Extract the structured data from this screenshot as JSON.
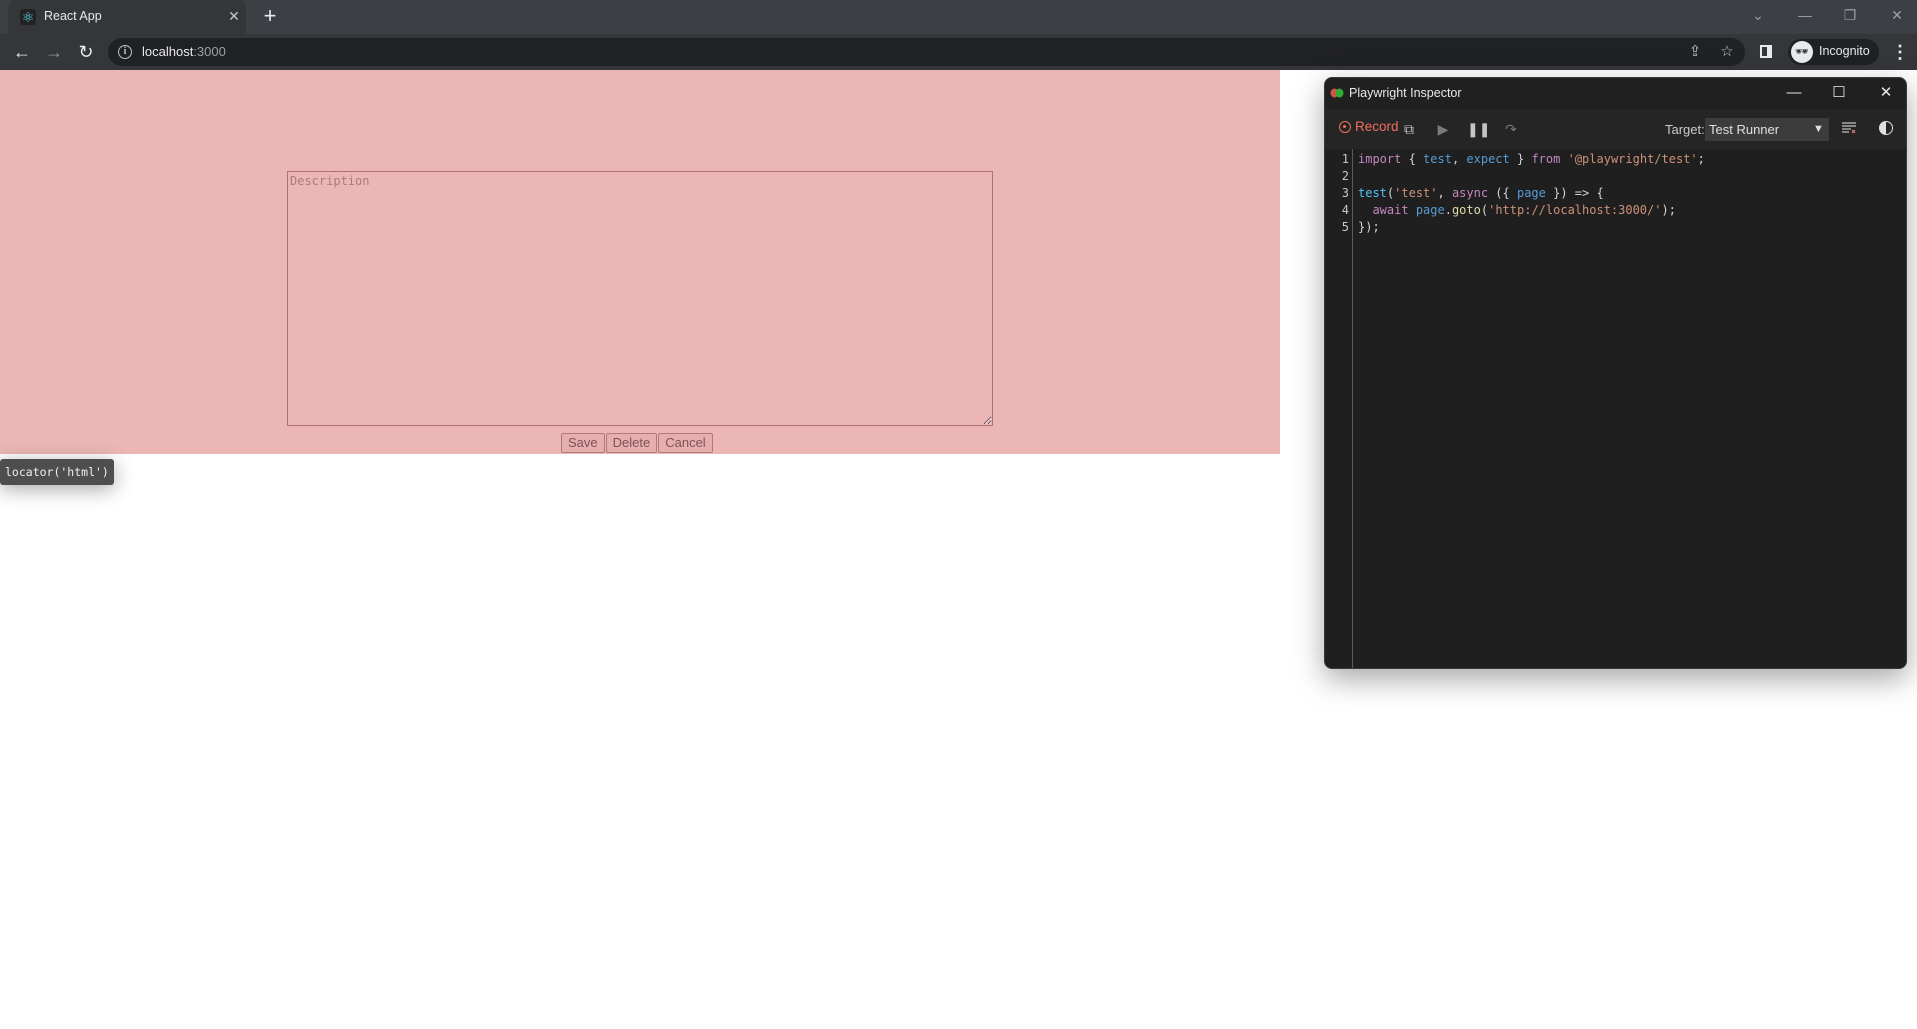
{
  "browser": {
    "tab": {
      "title": "React App",
      "favicon": "react-logo-icon",
      "close_icon": "close-icon"
    },
    "new_tab_icon": "plus-icon",
    "window_controls": [
      "tab-search-chevron-icon",
      "minimize-icon",
      "restore-icon",
      "close-icon"
    ],
    "nav": {
      "back": "arrow-left-icon",
      "forward": "arrow-right-icon",
      "reload": "reload-icon"
    },
    "address": {
      "host": "localhost",
      "port": ":3000",
      "site_info_icon": "info-icon"
    },
    "toolbar_icons": [
      "share-icon",
      "star-icon",
      "side-panel-icon"
    ],
    "profile": {
      "label": "Incognito",
      "icon": "incognito-icon"
    },
    "menu_icon": "kebab-menu-icon"
  },
  "page": {
    "background": "#ecb6b6",
    "description": {
      "placeholder": "Description",
      "value": ""
    },
    "buttons": {
      "save": "Save",
      "delete": "Delete",
      "cancel": "Cancel"
    },
    "locator_tooltip": "locator('html')"
  },
  "inspector": {
    "title": "Playwright Inspector",
    "toolbar": {
      "record_label": "Record",
      "record_color": "#f0705a",
      "icons": [
        "copy-icon",
        "resume-icon",
        "pause-icon",
        "step-over-icon"
      ],
      "target_label": "Target:",
      "target_value": "Test Runner",
      "clear_icon": "clear-icon",
      "theme_icon": "theme-toggle-icon"
    },
    "code_lines": [
      {
        "n": "1",
        "tokens": [
          [
            "kw",
            "import"
          ],
          [
            "punc",
            " { "
          ],
          [
            "id",
            "test"
          ],
          [
            "punc",
            ", "
          ],
          [
            "id",
            "expect"
          ],
          [
            "punc",
            " } "
          ],
          [
            "kw",
            "from"
          ],
          [
            "punc",
            " "
          ],
          [
            "str",
            "'@playwright/test'"
          ],
          [
            "punc",
            ";"
          ]
        ]
      },
      {
        "n": "2",
        "tokens": []
      },
      {
        "n": "3",
        "tokens": [
          [
            "fn",
            "test"
          ],
          [
            "punc",
            "("
          ],
          [
            "str",
            "'test'"
          ],
          [
            "punc",
            ", "
          ],
          [
            "kw",
            "async"
          ],
          [
            "punc",
            " ({ "
          ],
          [
            "id",
            "page"
          ],
          [
            "punc",
            " }) => {"
          ]
        ]
      },
      {
        "n": "4",
        "tokens": [
          [
            "punc",
            "  "
          ],
          [
            "kw",
            "await"
          ],
          [
            "punc",
            " "
          ],
          [
            "id",
            "page"
          ],
          [
            "punc",
            "."
          ],
          [
            "call",
            "goto"
          ],
          [
            "punc",
            "("
          ],
          [
            "str",
            "'http://localhost:3000/'"
          ],
          [
            "punc",
            ");"
          ]
        ]
      },
      {
        "n": "5",
        "tokens": [
          [
            "punc",
            "});"
          ]
        ]
      }
    ]
  }
}
